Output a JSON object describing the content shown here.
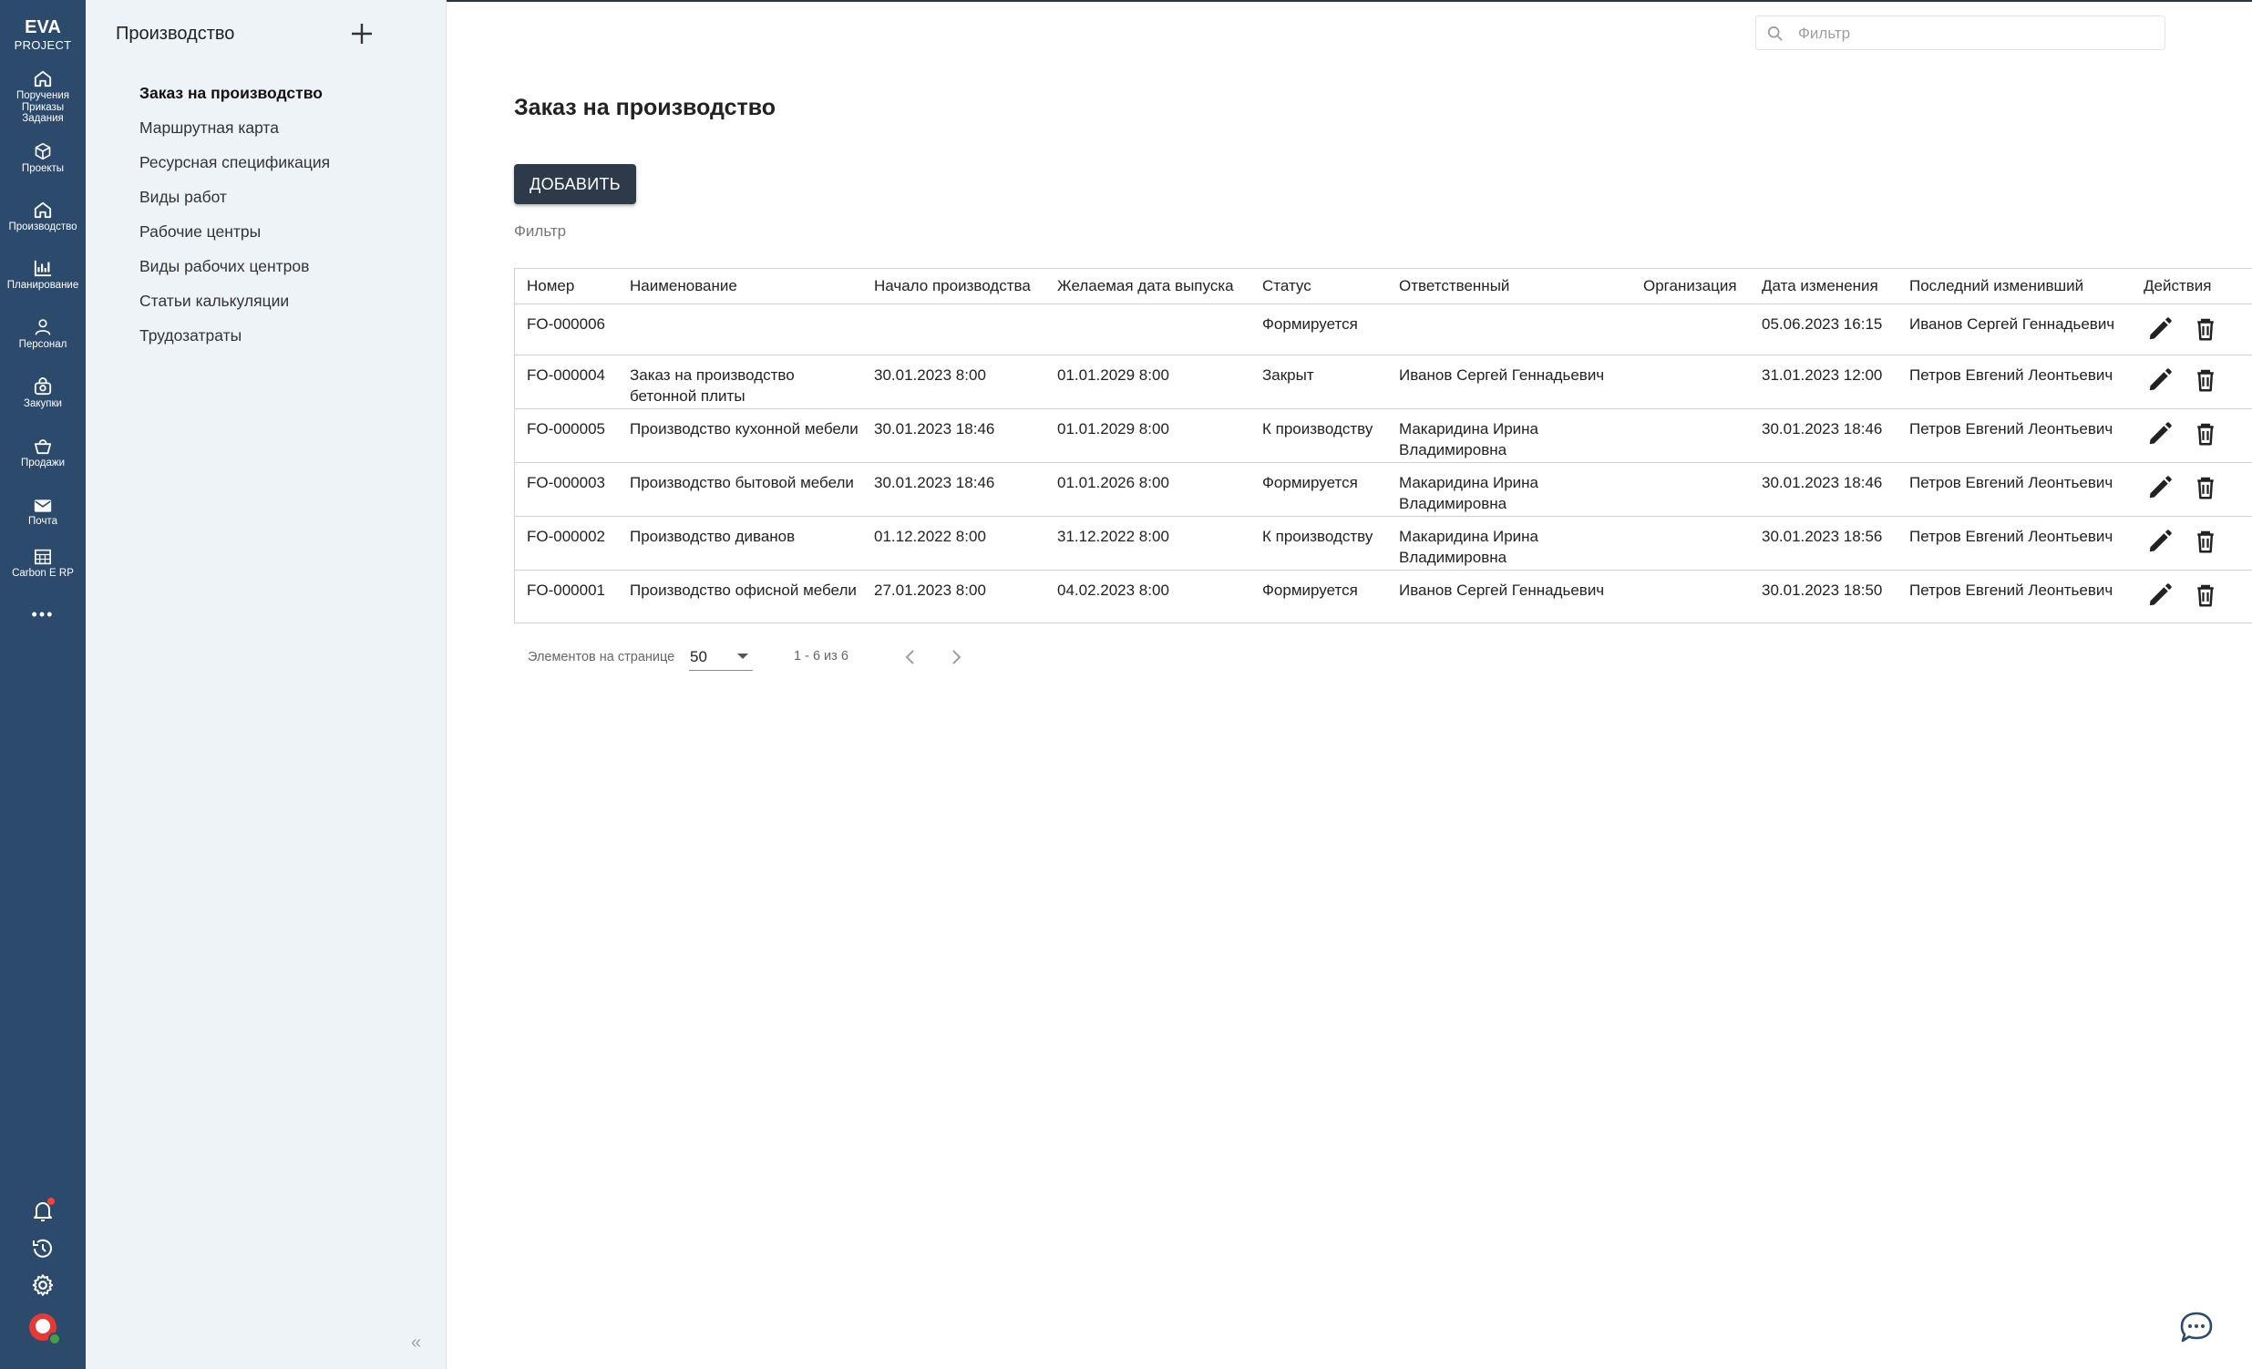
{
  "brand": {
    "line1": "EVA",
    "line2": "PROJECT"
  },
  "rail": {
    "items": [
      {
        "label": "Поручения Приказы Задания",
        "icon": "home-icon"
      },
      {
        "label": "Проекты",
        "icon": "cube-icon"
      },
      {
        "label": "Производство",
        "icon": "home-icon"
      },
      {
        "label": "Планирование",
        "icon": "chart-icon"
      },
      {
        "label": "Персонал",
        "icon": "person-icon"
      },
      {
        "label": "Закупки",
        "icon": "bag-icon"
      },
      {
        "label": "Продажи",
        "icon": "basket-icon"
      },
      {
        "label": "Почта",
        "icon": "mail-icon"
      },
      {
        "label": "Carbon E RP",
        "icon": "grid-icon"
      }
    ],
    "more": "•••"
  },
  "sidebar": {
    "title": "Производство",
    "items": [
      {
        "label": "Заказ на производство",
        "active": true
      },
      {
        "label": "Маршрутная карта"
      },
      {
        "label": "Ресурсная спецификация"
      },
      {
        "label": "Виды работ"
      },
      {
        "label": "Рабочие центры"
      },
      {
        "label": "Виды рабочих центров"
      },
      {
        "label": "Статьи калькуляции"
      },
      {
        "label": "Трудозатраты"
      }
    ],
    "collapse": "«"
  },
  "search": {
    "placeholder": "Фильтр",
    "value": ""
  },
  "main": {
    "title": "Заказ на производство",
    "add_label": "ДОБАВИТЬ",
    "filter_label": "Фильтр"
  },
  "table": {
    "columns": [
      "Номер",
      "Наименование",
      "Начало производства",
      "Желаемая дата выпуска",
      "Статус",
      "Ответственный",
      "Организация",
      "Дата изменения",
      "Последний изменивший",
      "Действия"
    ],
    "rows": [
      {
        "number": "FO-000006",
        "name": "",
        "start": "",
        "due": "",
        "status": "Формируется",
        "responsible": "",
        "org": "",
        "changed": "05.06.2023 16:15",
        "changed_by": "Иванов Сергей Геннадьевич"
      },
      {
        "number": "FO-000004",
        "name": "Заказ на производство бетонной плиты",
        "start": "30.01.2023 8:00",
        "due": "01.01.2029 8:00",
        "status": "Закрыт",
        "responsible": "Иванов Сергей Геннадьевич",
        "org": "",
        "changed": "31.01.2023 12:00",
        "changed_by": "Петров Евгений Леонтьевич"
      },
      {
        "number": "FO-000005",
        "name": "Производство кухонной мебели",
        "start": "30.01.2023 18:46",
        "due": "01.01.2029 8:00",
        "status": "К производству",
        "responsible": "Макаридина Ирина Владимировна",
        "org": "",
        "changed": "30.01.2023 18:46",
        "changed_by": "Петров Евгений Леонтьевич"
      },
      {
        "number": "FO-000003",
        "name": "Производство бытовой мебели",
        "start": "30.01.2023 18:46",
        "due": "01.01.2026 8:00",
        "status": "Формируется",
        "responsible": "Макаридина Ирина Владимировна",
        "org": "",
        "changed": "30.01.2023 18:46",
        "changed_by": "Петров Евгений Леонтьевич"
      },
      {
        "number": "FO-000002",
        "name": "Производство диванов",
        "start": "01.12.2022 8:00",
        "due": "31.12.2022 8:00",
        "status": "К производству",
        "responsible": "Макаридина Ирина Владимировна",
        "org": "",
        "changed": "30.01.2023 18:56",
        "changed_by": "Петров Евгений Леонтьевич"
      },
      {
        "number": "FO-000001",
        "name": "Производство офисной мебели",
        "start": "27.01.2023 8:00",
        "due": "04.02.2023 8:00",
        "status": "Формируется",
        "responsible": "Иванов Сергей Геннадьевич",
        "org": "",
        "changed": "30.01.2023 18:50",
        "changed_by": "Петров Евгений Леонтьевич"
      }
    ]
  },
  "pager": {
    "per_page_label": "Элементов на странице",
    "per_page": "50",
    "range": "1 - 6 из 6"
  },
  "colors": {
    "rail": "#2b4a6c",
    "sidebar": "#eef3f8",
    "button": "#2e3a4a",
    "chat": "#2b4a6c"
  }
}
